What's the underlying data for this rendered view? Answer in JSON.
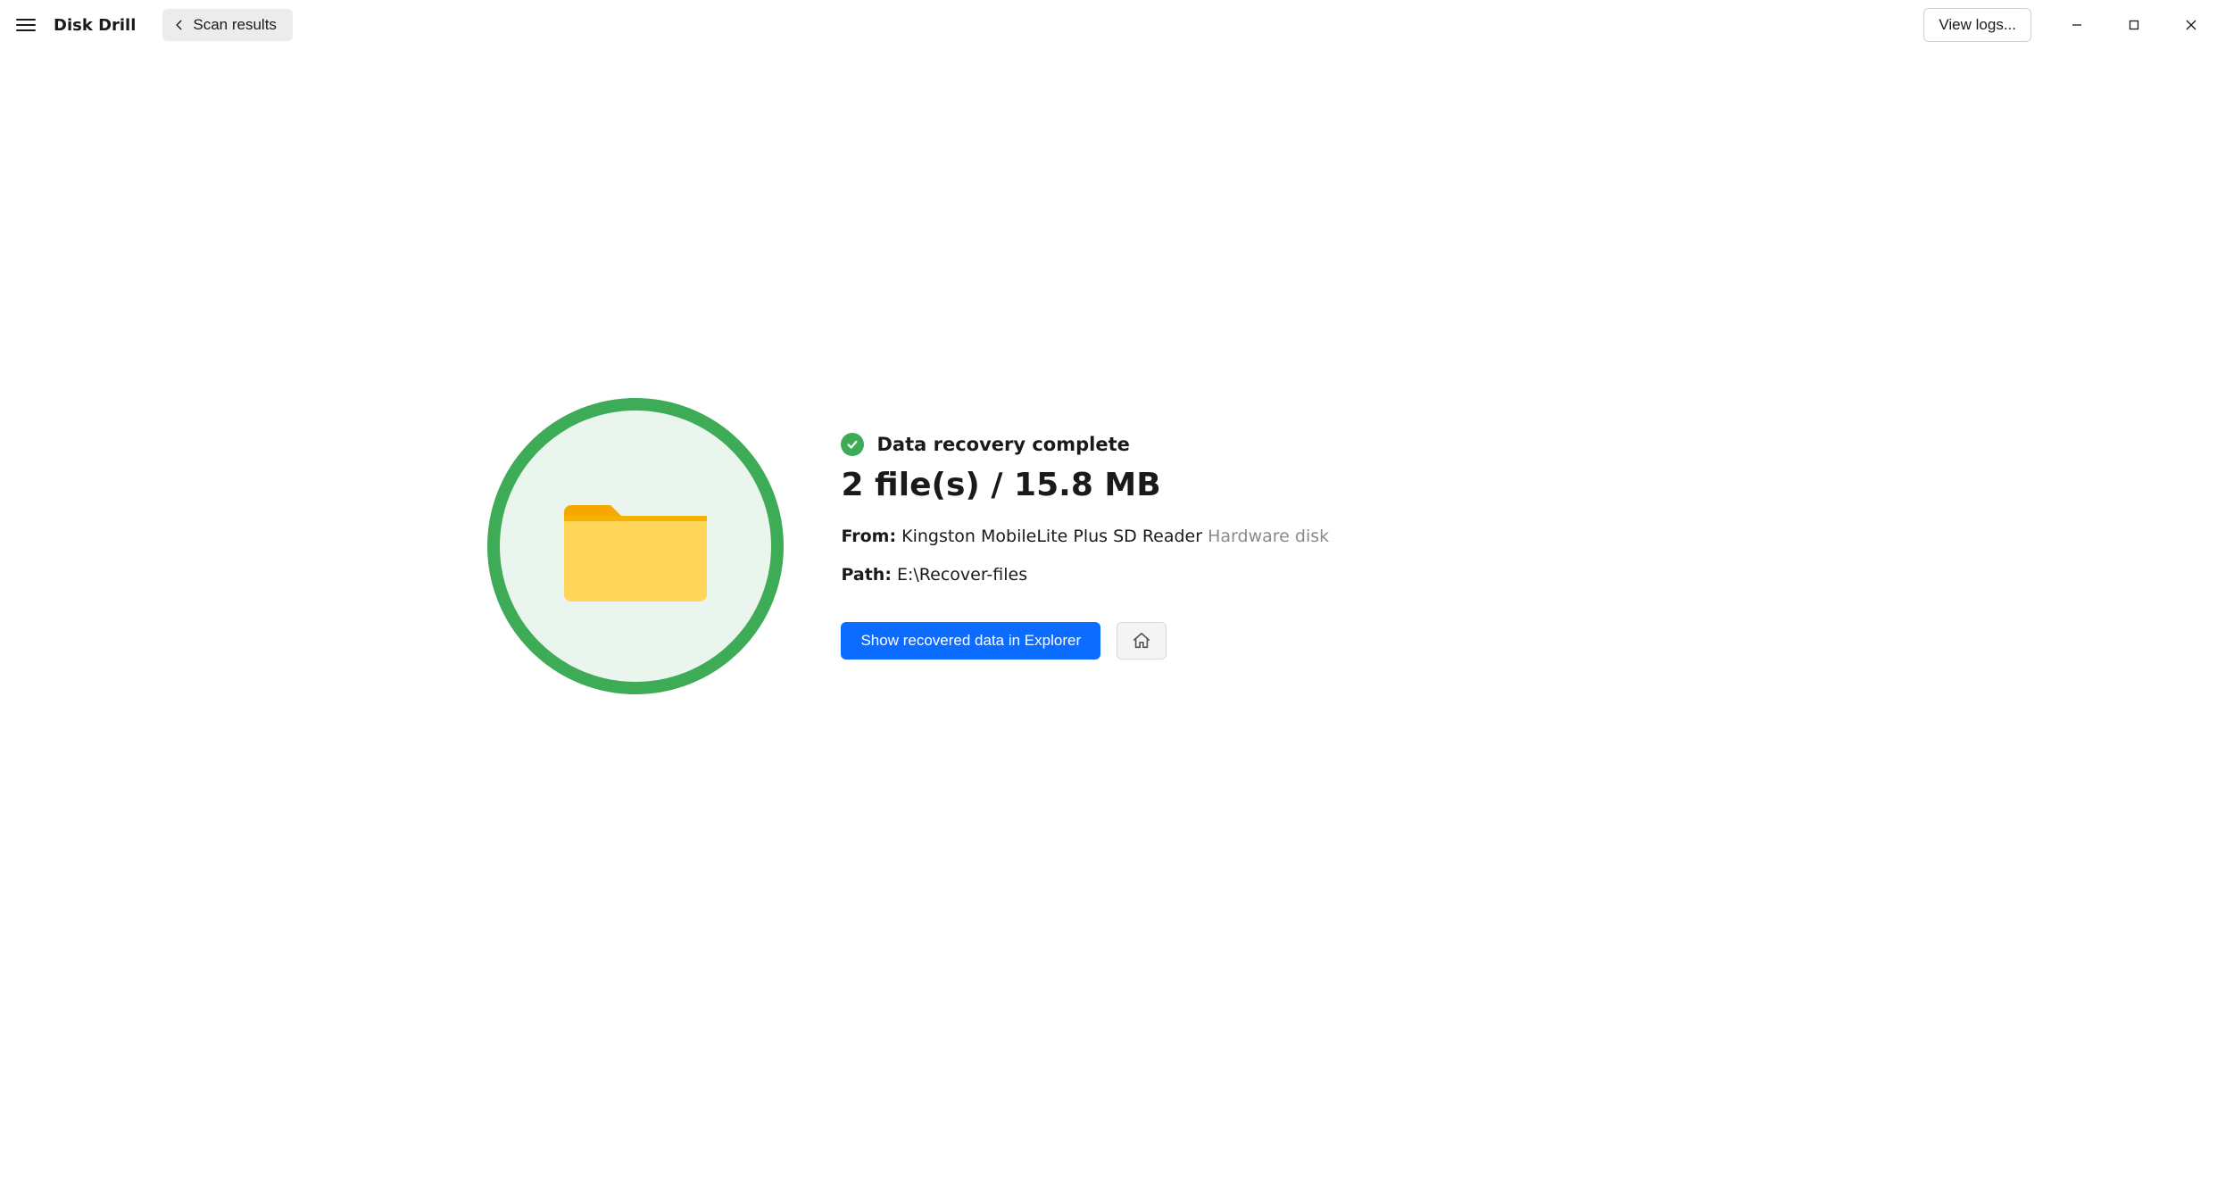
{
  "header": {
    "app_title": "Disk Drill",
    "back_label": "Scan results",
    "view_logs_label": "View logs..."
  },
  "result": {
    "status_label": "Data recovery complete",
    "summary_line": "2 file(s) / 15.8 MB",
    "from_key": "From:",
    "from_device": "Kingston MobileLite Plus SD Reader",
    "from_kind": "Hardware disk",
    "path_key": "Path:",
    "path_value": "E:\\Recover-files",
    "show_in_explorer_label": "Show recovered data in Explorer"
  }
}
